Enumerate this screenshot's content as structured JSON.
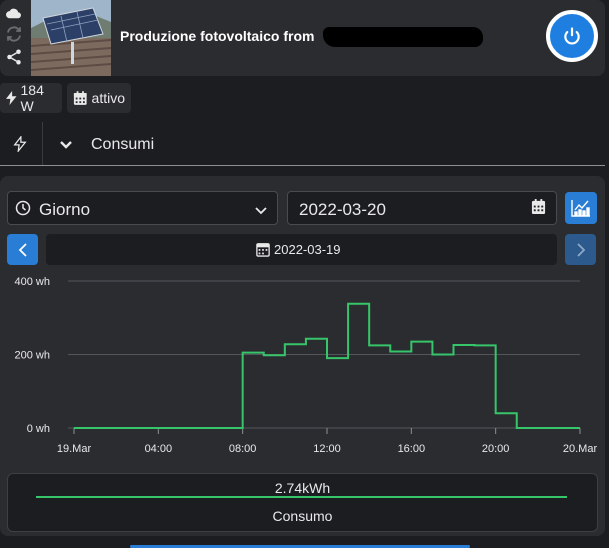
{
  "header": {
    "title": "Produzione fotovoltaico from"
  },
  "chips": {
    "power": "184 W",
    "status": "attivo"
  },
  "section": {
    "label": "Consumi"
  },
  "controls": {
    "period": "Giorno",
    "date": "2022-03-20",
    "nav_date": "2022-03-19"
  },
  "chart_data": {
    "type": "line",
    "step": true,
    "x_ticks": [
      "19.Mar",
      "04:00",
      "08:00",
      "12:00",
      "16:00",
      "20:00",
      "20.Mar"
    ],
    "y_ticks": [
      "0 wh",
      "200 wh",
      "400 wh"
    ],
    "ylim": [
      0,
      400
    ],
    "xlim": [
      0,
      24
    ],
    "series": [
      {
        "color": "#36c56a",
        "x": [
          0,
          1,
          2,
          3,
          4,
          5,
          6,
          7,
          8,
          9,
          10,
          11,
          12,
          13,
          14,
          15,
          16,
          17,
          18,
          19,
          20,
          21,
          22,
          23
        ],
        "values": [
          0,
          0,
          0,
          0,
          0,
          0,
          0,
          0,
          205,
          198,
          228,
          243,
          190,
          338,
          225,
          208,
          235,
          200,
          226,
          225,
          40,
          0,
          0,
          0
        ]
      }
    ]
  },
  "summary": {
    "value": "2.74kWh",
    "label": "Consumo"
  }
}
